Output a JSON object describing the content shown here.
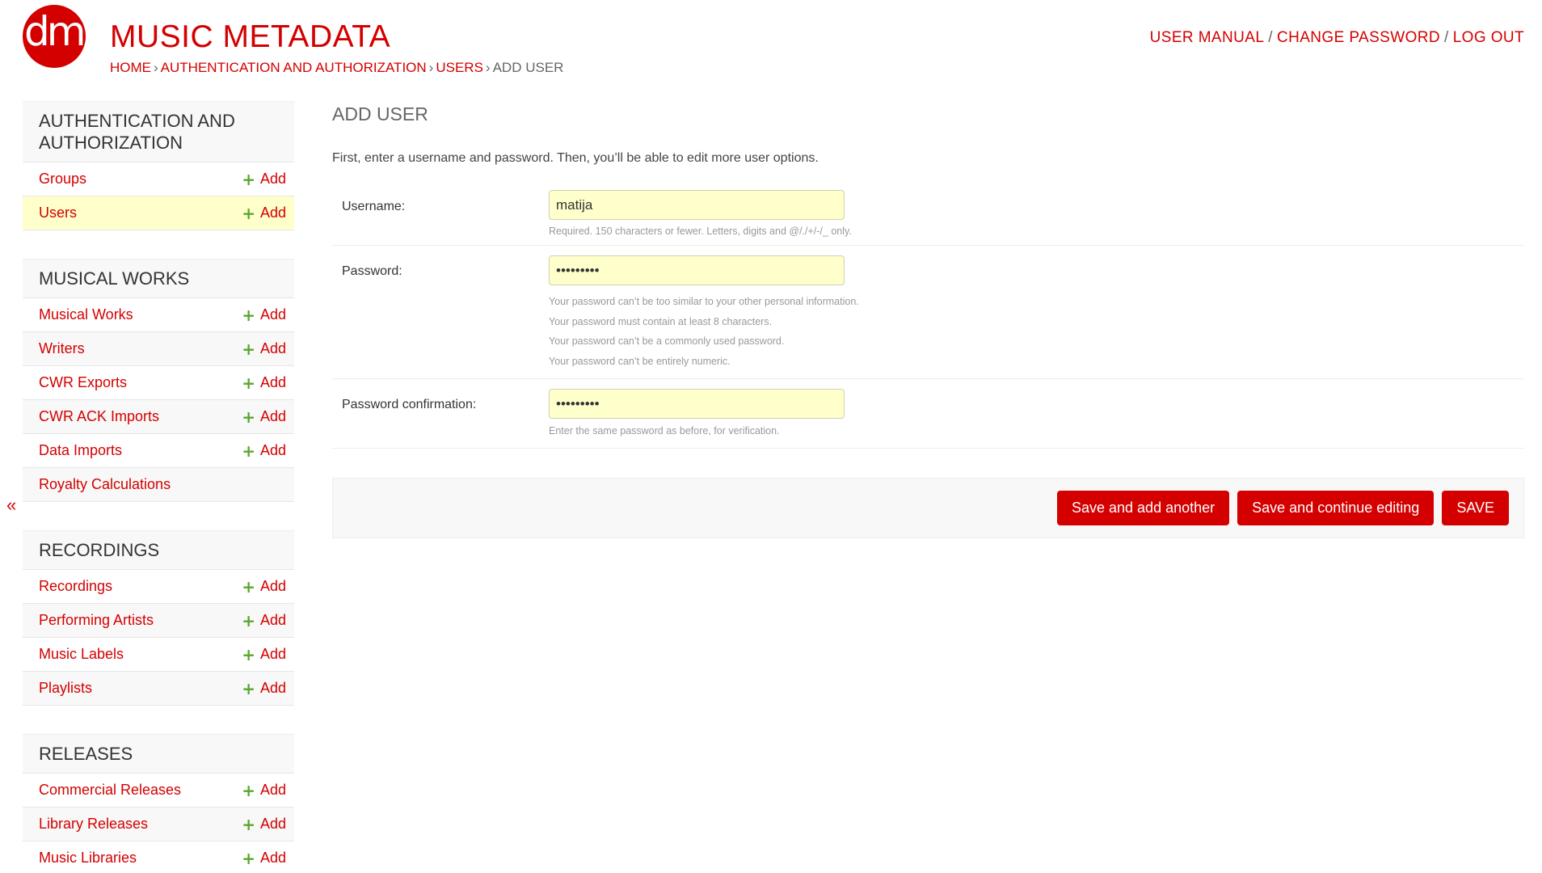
{
  "header": {
    "logo_text": "dmp",
    "site_title": "MUSIC METADATA",
    "breadcrumbs": [
      "HOME",
      "AUTHENTICATION AND AUTHORIZATION",
      "USERS",
      "ADD USER"
    ],
    "breadcrumb_separator": "›",
    "user_tools": [
      "USER MANUAL",
      "CHANGE PASSWORD",
      "LOG OUT"
    ]
  },
  "sidebar": {
    "collapse_label": "«",
    "add_label": "Add",
    "modules": [
      {
        "caption": "AUTHENTICATION AND AUTHORIZATION",
        "models": [
          {
            "name": "Groups",
            "has_add": true
          },
          {
            "name": "Users",
            "has_add": true,
            "selected": true
          }
        ]
      },
      {
        "caption": "MUSICAL WORKS",
        "models": [
          {
            "name": "Musical Works",
            "has_add": true
          },
          {
            "name": "Writers",
            "has_add": true
          },
          {
            "name": "CWR Exports",
            "has_add": true
          },
          {
            "name": "CWR ACK Imports",
            "has_add": true
          },
          {
            "name": "Data Imports",
            "has_add": true
          },
          {
            "name": "Royalty Calculations",
            "has_add": false
          }
        ]
      },
      {
        "caption": "RECORDINGS",
        "models": [
          {
            "name": "Recordings",
            "has_add": true
          },
          {
            "name": "Performing Artists",
            "has_add": true
          },
          {
            "name": "Music Labels",
            "has_add": true
          },
          {
            "name": "Playlists",
            "has_add": true
          }
        ]
      },
      {
        "caption": "RELEASES",
        "models": [
          {
            "name": "Commercial Releases",
            "has_add": true
          },
          {
            "name": "Library Releases",
            "has_add": true
          },
          {
            "name": "Music Libraries",
            "has_add": true
          }
        ]
      }
    ]
  },
  "content": {
    "heading": "ADD USER",
    "intro": "First, enter a username and password. Then, you’ll be able to edit more user options.",
    "username": {
      "label": "Username:",
      "value": "matija",
      "help": "Required. 150 characters or fewer. Letters, digits and @/./+/-/_ only."
    },
    "password": {
      "label": "Password:",
      "value": "•••••••••",
      "help": [
        "Your password can’t be too similar to your other personal information.",
        "Your password must contain at least 8 characters.",
        "Your password can’t be a commonly used password.",
        "Your password can’t be entirely numeric."
      ]
    },
    "password_confirmation": {
      "label": "Password confirmation:",
      "value": "•••••••••",
      "help": "Enter the same password as before, for verification."
    },
    "buttons": {
      "save_add_another": "Save and add another",
      "save_continue": "Save and continue editing",
      "save": "SAVE"
    }
  },
  "colors": {
    "brand": "#d40000",
    "add_plus": "#5aa62f",
    "highlight": "#ffffcc"
  }
}
